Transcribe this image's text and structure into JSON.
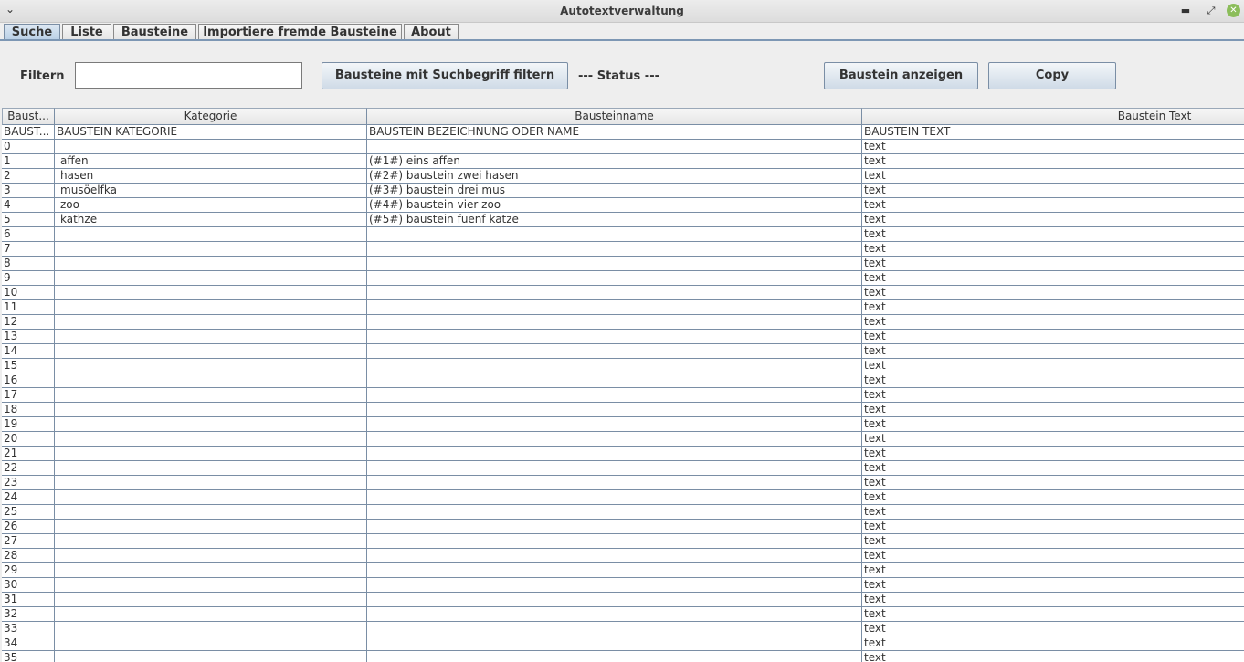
{
  "window": {
    "title": "Autotextverwaltung"
  },
  "tabs": [
    {
      "label": "Suche",
      "active": true
    },
    {
      "label": "Liste",
      "active": false
    },
    {
      "label": "Bausteine",
      "active": false
    },
    {
      "label": "Importiere fremde Bausteine",
      "active": false
    },
    {
      "label": "About",
      "active": false
    }
  ],
  "toolbar": {
    "filter_label": "Filtern",
    "filter_value": "",
    "filter_button": "Bausteine mit Suchbegriff filtern",
    "status": "--- Status ---",
    "show_button": "Baustein anzeigen",
    "copy_button": "Copy"
  },
  "table": {
    "headers": [
      "Baust...",
      "Kategorie",
      "Bausteinname",
      "Baustein Text"
    ],
    "rows": [
      [
        "BAUST...",
        "BAUSTEIN KATEGORIE",
        "BAUSTEIN BEZEICHNUNG ODER NAME",
        "BAUSTEIN TEXT"
      ],
      [
        "0",
        "",
        "",
        "text"
      ],
      [
        "1",
        "affen",
        "(#1#) eins affen",
        "text"
      ],
      [
        "2",
        "hasen",
        "(#2#) baustein zwei hasen",
        "text"
      ],
      [
        "3",
        "musöelfka",
        "(#3#) baustein drei mus",
        "text"
      ],
      [
        "4",
        "zoo",
        "(#4#) baustein vier zoo",
        "text"
      ],
      [
        "5",
        "kathze",
        "(#5#) baustein fuenf katze",
        "text"
      ],
      [
        "6",
        "",
        "",
        "text"
      ],
      [
        "7",
        "",
        "",
        "text"
      ],
      [
        "8",
        "",
        "",
        "text"
      ],
      [
        "9",
        "",
        "",
        "text"
      ],
      [
        "10",
        "",
        "",
        "text"
      ],
      [
        "11",
        "",
        "",
        "text"
      ],
      [
        "12",
        "",
        "",
        "text"
      ],
      [
        "13",
        "",
        "",
        "text"
      ],
      [
        "14",
        "",
        "",
        "text"
      ],
      [
        "15",
        "",
        "",
        "text"
      ],
      [
        "16",
        "",
        "",
        "text"
      ],
      [
        "17",
        "",
        "",
        "text"
      ],
      [
        "18",
        "",
        "",
        "text"
      ],
      [
        "19",
        "",
        "",
        "text"
      ],
      [
        "20",
        "",
        "",
        "text"
      ],
      [
        "21",
        "",
        "",
        "text"
      ],
      [
        "22",
        "",
        "",
        "text"
      ],
      [
        "23",
        "",
        "",
        "text"
      ],
      [
        "24",
        "",
        "",
        "text"
      ],
      [
        "25",
        "",
        "",
        "text"
      ],
      [
        "26",
        "",
        "",
        "text"
      ],
      [
        "27",
        "",
        "",
        "text"
      ],
      [
        "28",
        "",
        "",
        "text"
      ],
      [
        "29",
        "",
        "",
        "text"
      ],
      [
        "30",
        "",
        "",
        "text"
      ],
      [
        "31",
        "",
        "",
        "text"
      ],
      [
        "32",
        "",
        "",
        "text"
      ],
      [
        "33",
        "",
        "",
        "text"
      ],
      [
        "34",
        "",
        "",
        "text"
      ],
      [
        "35",
        "",
        "",
        "text"
      ]
    ]
  }
}
